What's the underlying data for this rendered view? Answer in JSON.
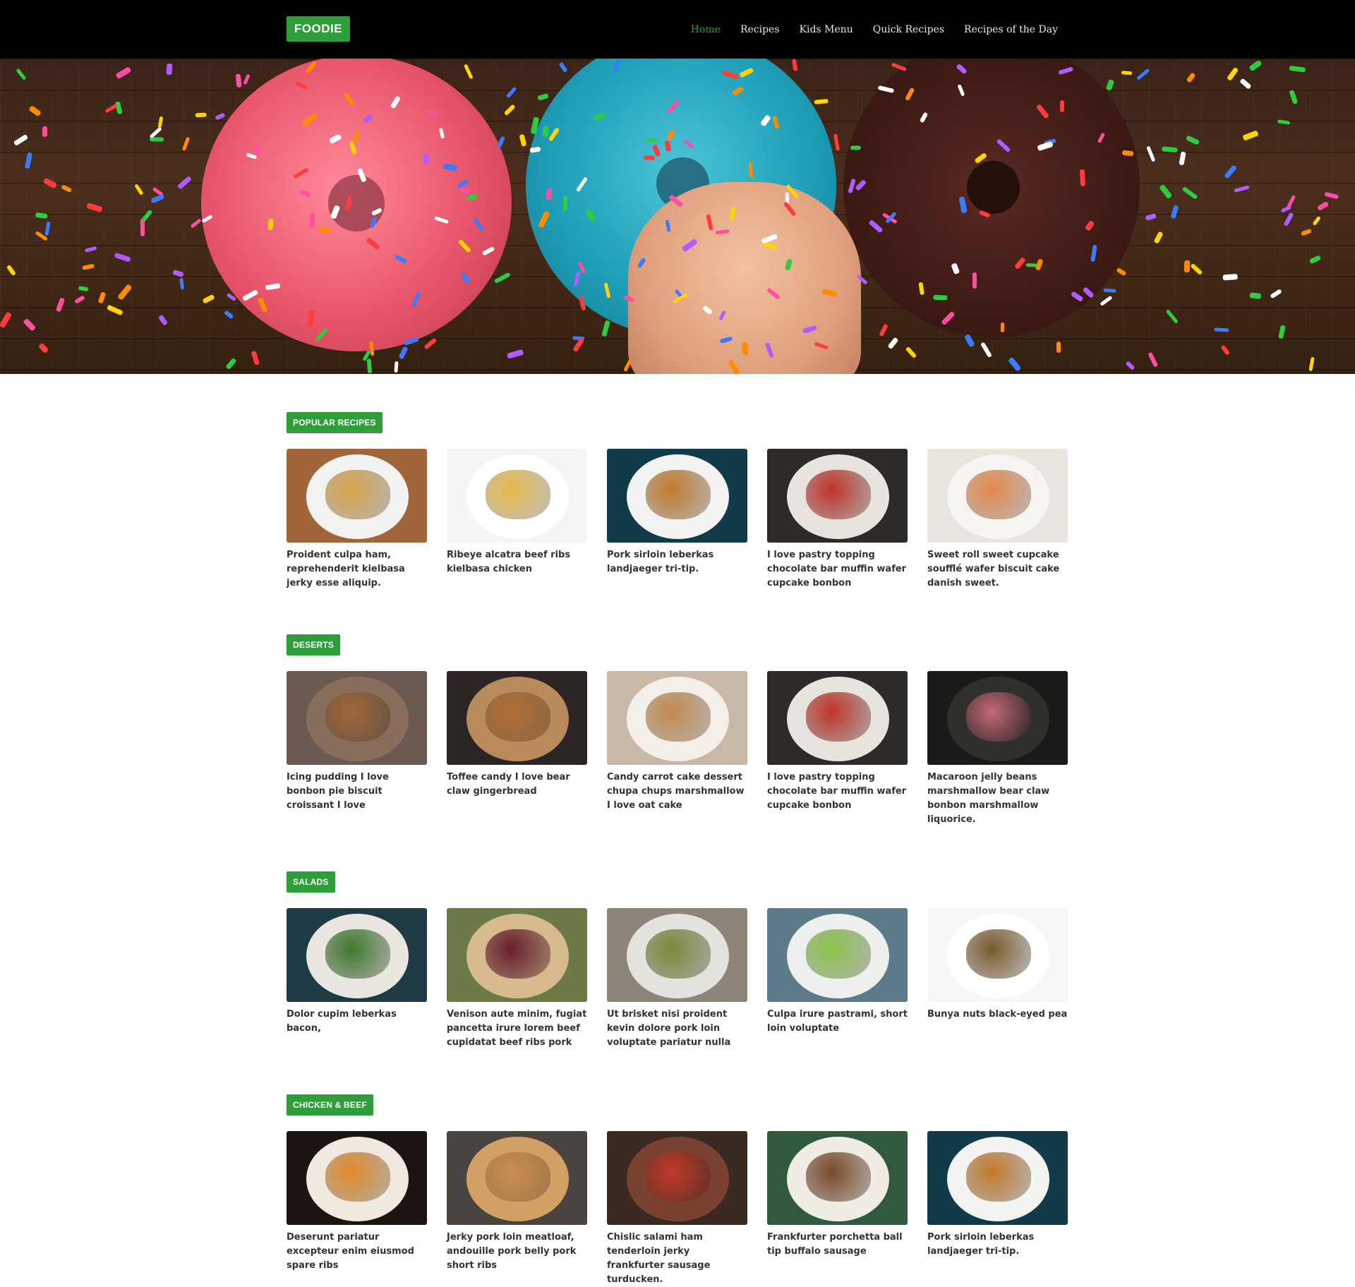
{
  "header": {
    "logo": "FOODIE",
    "nav": [
      {
        "label": "Home",
        "active": true
      },
      {
        "label": "Recipes",
        "active": false
      },
      {
        "label": "Kids Menu",
        "active": false
      },
      {
        "label": "Quick Recipes",
        "active": false
      },
      {
        "label": "Recipes of the Day",
        "active": false
      }
    ]
  },
  "colors": {
    "accent": "#2e9e3a",
    "header_bg": "#000000",
    "text": "#333333"
  },
  "sections": [
    {
      "title": "POPULAR RECIPES",
      "items": [
        {
          "caption": "Proident culpa ham, reprehenderit kielbasa jerky esse aliquip.",
          "bg": "#a0663a",
          "plate": "#f2f2f0",
          "food": "#d9a24a"
        },
        {
          "caption": "Ribeye alcatra beef ribs kielbasa chicken",
          "bg": "#f5f5f3",
          "plate": "#ffffff",
          "food": "#e6b84a"
        },
        {
          "caption": "Pork sirloin leberkas landjaeger tri-tip.",
          "bg": "#123b4a",
          "plate": "#f3f3f1",
          "food": "#c27a2c"
        },
        {
          "caption": "I love pastry topping chocolate bar muffin wafer cupcake bonbon",
          "bg": "#2e2a28",
          "plate": "#e8e3dc",
          "food": "#c0342c"
        },
        {
          "caption": "Sweet roll sweet cupcake soufflé wafer biscuit cake danish sweet.",
          "bg": "#e9e4dc",
          "plate": "#f7f5f1",
          "food": "#e58a4e"
        }
      ]
    },
    {
      "title": "DESERTS",
      "items": [
        {
          "caption": "Icing pudding I love bonbon pie biscuit croissant I love",
          "bg": "#6b5a52",
          "plate": "#8a6e5c",
          "food": "#a0683a"
        },
        {
          "caption": "Toffee candy I love bear claw gingerbread",
          "bg": "#2b2624",
          "plate": "#b98a5c",
          "food": "#b06e35"
        },
        {
          "caption": "Candy carrot cake dessert chupa chups marshmallow I love oat cake",
          "bg": "#c9b8a6",
          "plate": "#f4efe8",
          "food": "#c48a4e"
        },
        {
          "caption": "I love pastry topping chocolate bar muffin wafer cupcake bonbon",
          "bg": "#2e2a28",
          "plate": "#e8e3dc",
          "food": "#c0342c"
        },
        {
          "caption": "Macaroon jelly beans marshmallow bear claw bonbon marshmallow liquorice.",
          "bg": "#1a1a18",
          "plate": "#2f2f2b",
          "food": "#c56a78"
        }
      ]
    },
    {
      "title": "SALADS",
      "items": [
        {
          "caption": "Dolor cupim leberkas bacon,",
          "bg": "#1e3a44",
          "plate": "#e9e6df",
          "food": "#3f7a2e"
        },
        {
          "caption": "Venison aute minim, fugiat pancetta irure lorem beef cupidatat beef ribs pork",
          "bg": "#6c7a48",
          "plate": "#d9b98e",
          "food": "#6a1f2e"
        },
        {
          "caption": "Ut brisket nisi proident kevin dolore pork loin voluptate pariatur nulla",
          "bg": "#8c8579",
          "plate": "#e4e2dc",
          "food": "#7b8a3a"
        },
        {
          "caption": "Culpa irure pastrami, short loin voluptate",
          "bg": "#5d7a8a",
          "plate": "#eef0ee",
          "food": "#8bc34a"
        },
        {
          "caption": "Bunya nuts black-eyed pea",
          "bg": "#f7f7f5",
          "plate": "#ffffff",
          "food": "#7a5a2e"
        }
      ]
    },
    {
      "title": "CHICKEN & BEEF",
      "items": [
        {
          "caption": "Deserunt pariatur excepteur enim eiusmod spare ribs",
          "bg": "#1c1411",
          "plate": "#efe9e0",
          "food": "#e08a2a"
        },
        {
          "caption": "Jerky pork loin meatloaf, andouille pork belly pork short ribs",
          "bg": "#4a4440",
          "plate": "#d2a064",
          "food": "#c98e4e"
        },
        {
          "caption": "Chislic salami ham tenderloin jerky frankfurter sausage turducken.",
          "bg": "#3a2a22",
          "plate": "#7a4030",
          "food": "#c03a2a"
        },
        {
          "caption": "Frankfurter porchetta ball tip buffalo sausage",
          "bg": "#2f5a3e",
          "plate": "#f1ece4",
          "food": "#7a4a2a"
        },
        {
          "caption": "Pork sirloin leberkas landjaeger tri-tip.",
          "bg": "#123b4a",
          "plate": "#f3f3f1",
          "food": "#c27a2c"
        }
      ]
    }
  ]
}
